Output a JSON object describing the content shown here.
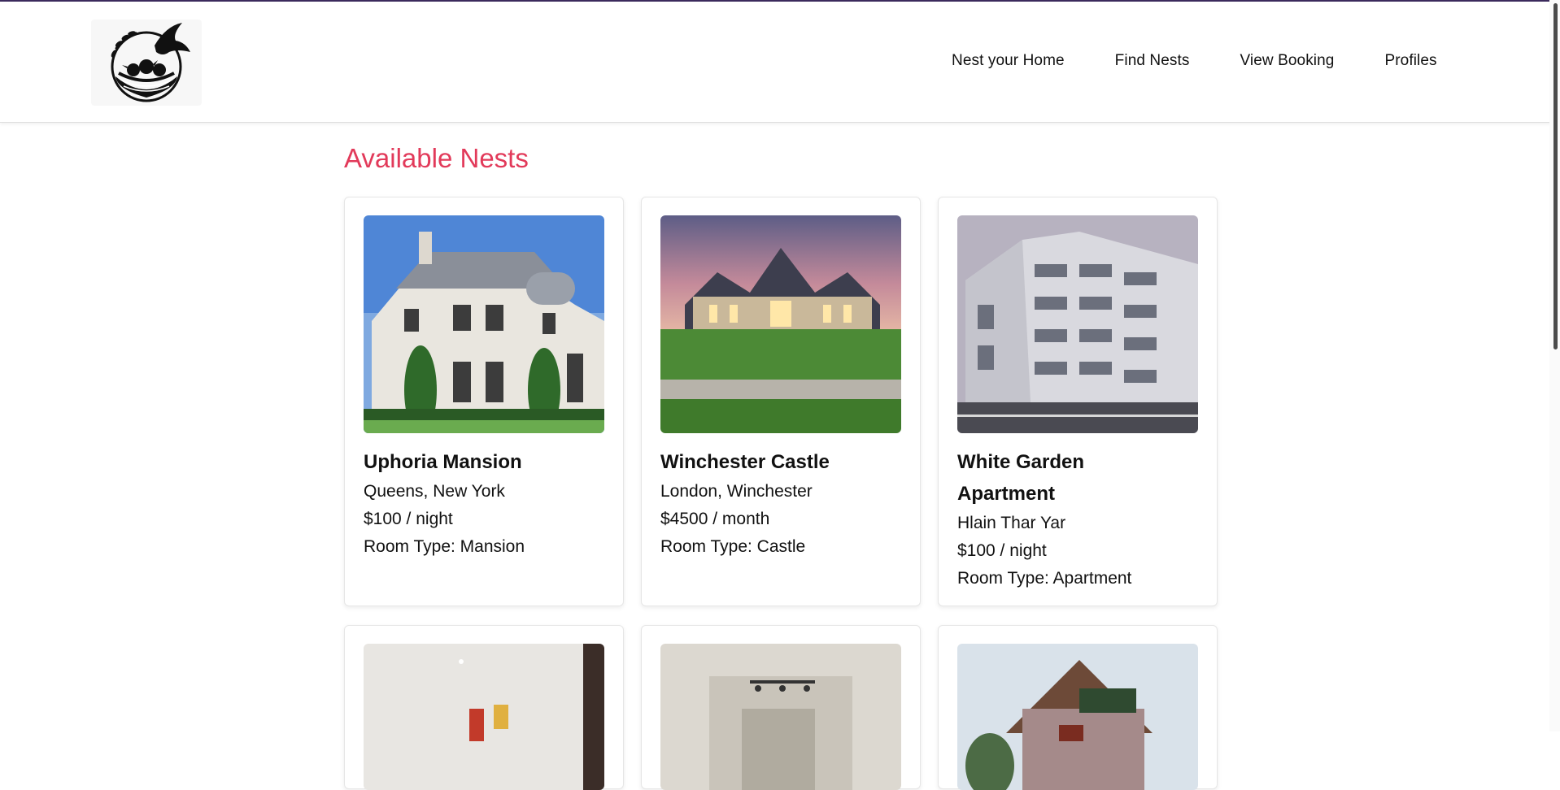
{
  "nav": {
    "items": [
      "Nest your Home",
      "Find Nests",
      "View Booking",
      "Profiles"
    ]
  },
  "page": {
    "title": "Available Nests"
  },
  "listings": [
    {
      "name": "Uphoria Mansion",
      "location": "Queens, New York",
      "price": "$100 / night",
      "room_type": "Room Type: Mansion"
    },
    {
      "name": "Winchester Castle",
      "location": "London, Winchester",
      "price": "$4500 / month",
      "room_type": "Room Type: Castle"
    },
    {
      "name": "White Garden Apartment",
      "location": "Hlain Thar Yar",
      "price": "$100 / night",
      "room_type": "Room Type: Apartment"
    }
  ]
}
